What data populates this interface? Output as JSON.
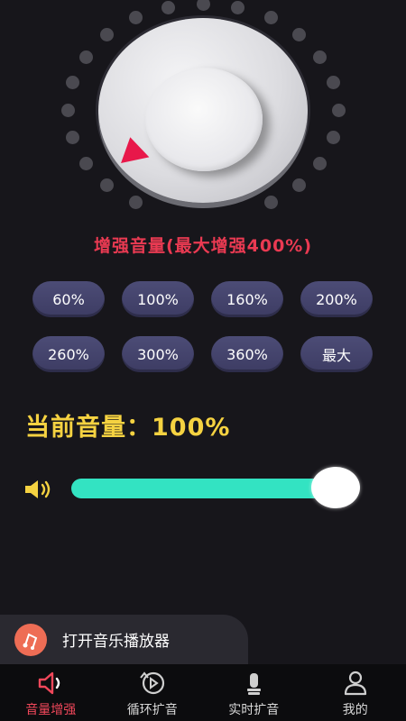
{
  "colors": {
    "background": "#17161b",
    "accent_red": "#ea3a52",
    "yellow": "#f5d241",
    "slider": "#33e3c2",
    "preset_button": "#45446c",
    "music_icon": "#ee6d55"
  },
  "boost": {
    "title": "增强音量(最大增强400%)"
  },
  "presets": [
    "60%",
    "100%",
    "160%",
    "200%",
    "260%",
    "300%",
    "360%",
    "最大"
  ],
  "current": {
    "label": "当前音量：100%"
  },
  "volume_slider": {
    "value_fraction": 0.95
  },
  "music_player": {
    "label": "打开音乐播放器",
    "icon": "music-note-icon"
  },
  "nav": {
    "items": [
      {
        "label": "音量增强",
        "icon": "speaker-icon",
        "active": true
      },
      {
        "label": "循环扩音",
        "icon": "loop-play-icon",
        "active": false
      },
      {
        "label": "实时扩音",
        "icon": "microphone-icon",
        "active": false
      },
      {
        "label": "我的",
        "icon": "profile-icon",
        "active": false
      }
    ]
  }
}
